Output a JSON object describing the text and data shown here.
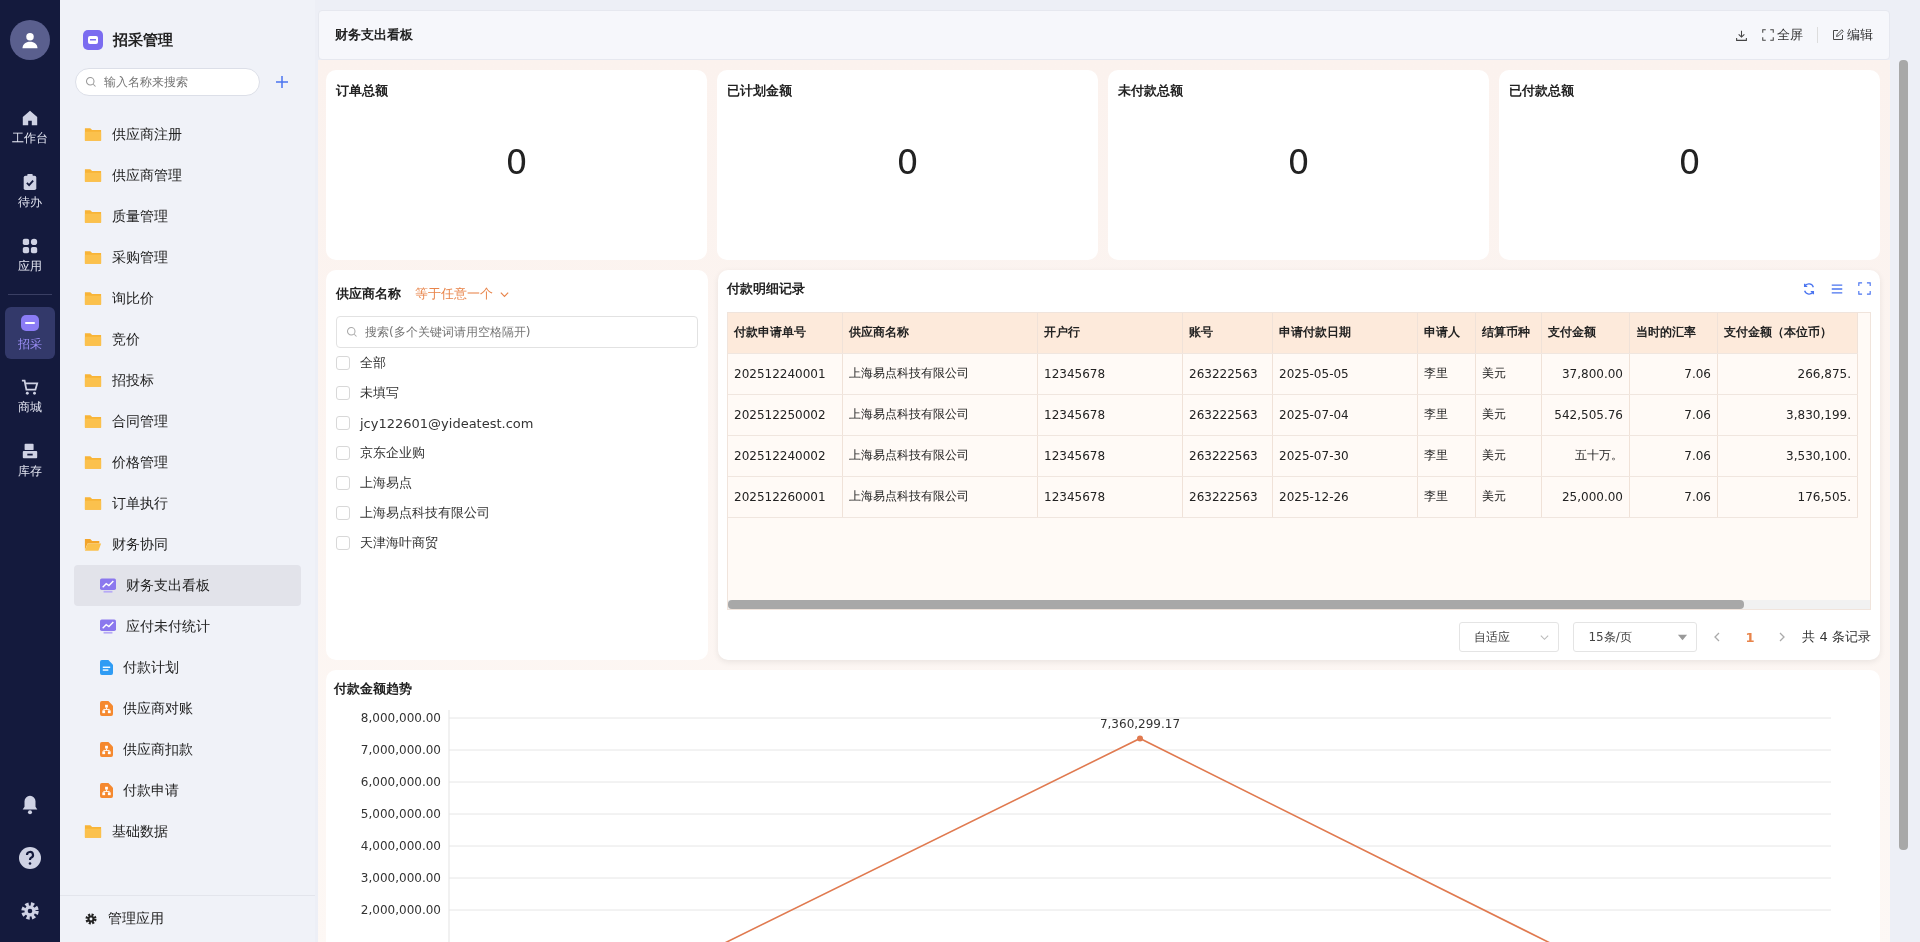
{
  "nav": {
    "items": [
      {
        "label": "工作台",
        "kind": "home",
        "selected": false
      },
      {
        "label": "待办",
        "kind": "todo",
        "selected": false
      },
      {
        "label": "应用",
        "kind": "apps",
        "selected": false
      },
      {
        "label": "招采",
        "kind": "srm",
        "selected": true
      },
      {
        "label": "商城",
        "kind": "cart",
        "selected": false
      },
      {
        "label": "库存",
        "kind": "stock",
        "selected": false
      }
    ]
  },
  "sidebar": {
    "title": "招采管理",
    "search": {
      "placeholder": "输入名称来搜索"
    },
    "items": [
      {
        "label": "供应商注册",
        "kind": "folder",
        "expanded": false,
        "selected": false
      },
      {
        "label": "供应商管理",
        "kind": "folder",
        "expanded": false,
        "selected": false
      },
      {
        "label": "质量管理",
        "kind": "folder",
        "expanded": false,
        "selected": false
      },
      {
        "label": "采购管理",
        "kind": "folder",
        "expanded": false,
        "selected": false
      },
      {
        "label": "询比价",
        "kind": "folder",
        "expanded": false,
        "selected": false
      },
      {
        "label": "竞价",
        "kind": "folder",
        "expanded": false,
        "selected": false
      },
      {
        "label": "招投标",
        "kind": "folder",
        "expanded": false,
        "selected": false
      },
      {
        "label": "合同管理",
        "kind": "folder",
        "expanded": false,
        "selected": false
      },
      {
        "label": "价格管理",
        "kind": "folder",
        "expanded": false,
        "selected": false
      },
      {
        "label": "订单执行",
        "kind": "folder",
        "expanded": false,
        "selected": false
      },
      {
        "label": "财务协同",
        "kind": "folder",
        "expanded": true,
        "selected": false,
        "children": [
          {
            "label": "财务支出看板",
            "kind": "chart",
            "selected": true
          },
          {
            "label": "应付未付统计",
            "kind": "chart",
            "selected": false
          },
          {
            "label": "付款计划",
            "kind": "doc",
            "selected": false
          },
          {
            "label": "供应商对账",
            "kind": "org",
            "selected": false
          },
          {
            "label": "供应商扣款",
            "kind": "org",
            "selected": false
          },
          {
            "label": "付款申请",
            "kind": "org",
            "selected": false
          }
        ]
      },
      {
        "label": "基础数据",
        "kind": "folder",
        "expanded": false,
        "selected": false
      }
    ],
    "footer": "管理应用"
  },
  "header": {
    "title": "财务支出看板",
    "actions": [
      {
        "kind": "download"
      },
      {
        "kind": "fullscreen",
        "label": "全屏"
      },
      {
        "kind": "edit",
        "label": "编辑"
      }
    ]
  },
  "cards": [
    {
      "title": "订单总额",
      "value": "0"
    },
    {
      "title": "已计划金额",
      "value": "0"
    },
    {
      "title": "未付款总额",
      "value": "0"
    },
    {
      "title": "已付款总额",
      "value": "0"
    }
  ],
  "filter": {
    "label": "供应商名称",
    "operator": "等于任意一个",
    "search": {
      "placeholder": "搜索(多个关键词请用空格隔开)"
    },
    "options": [
      {
        "label": "全部",
        "checked": false
      },
      {
        "label": "未填写",
        "checked": false
      },
      {
        "label": "jcy122601@yideatest.com",
        "checked": false
      },
      {
        "label": "京东企业购",
        "checked": false
      },
      {
        "label": "上海易点",
        "checked": false
      },
      {
        "label": "上海易点科技有限公司",
        "checked": false
      },
      {
        "label": "天津海叶商贸",
        "checked": false
      }
    ]
  },
  "table": {
    "title": "付款明细记录",
    "columns": [
      "付款申请单号",
      "供应商名称",
      "开户行",
      "账号",
      "申请付款日期",
      "申请人",
      "结算币种",
      "支付金额",
      "当时的汇率",
      "支付金额（本位币）"
    ],
    "rows": [
      [
        "202512240001",
        "上海易点科技有限公司",
        "12345678",
        "263222563",
        "2025-05-05",
        "李里",
        "美元",
        "37,800.00",
        "7.06",
        "266,875."
      ],
      [
        "202512250002",
        "上海易点科技有限公司",
        "12345678",
        "263222563",
        "2025-07-04",
        "李里",
        "美元",
        "542,505.76",
        "7.06",
        "3,830,199."
      ],
      [
        "202512240002",
        "上海易点科技有限公司",
        "12345678",
        "263222563",
        "2025-07-30",
        "李里",
        "美元",
        "五十万。",
        "7.06",
        "3,530,100."
      ],
      [
        "202512260001",
        "上海易点科技有限公司",
        "12345678",
        "263222563",
        "2025-12-26",
        "李里",
        "美元",
        "25,000.00",
        "7.06",
        "176,505."
      ]
    ],
    "pagination": {
      "fit": "自适应",
      "page_size": "15条/页",
      "pages": [
        {
          "label": "1",
          "selected": true
        }
      ],
      "total": "共 4 条记录"
    }
  },
  "trend": {
    "title": "付款金额趋势",
    "chart_data": {
      "type": "line",
      "ylim": [
        0,
        8000000
      ],
      "yticks": [
        {
          "value": 2000000,
          "label": "2,000,000.00"
        },
        {
          "value": 3000000,
          "label": "3,000,000.00"
        },
        {
          "value": 4000000,
          "label": "4,000,000.00"
        },
        {
          "value": 5000000,
          "label": "5,000,000.00"
        },
        {
          "value": 6000000,
          "label": "6,000,000.00"
        },
        {
          "value": 7000000,
          "label": "7,000,000.00"
        },
        {
          "value": 8000000,
          "label": "8,000,000.00"
        }
      ],
      "grid": true,
      "series": [
        {
          "color": "#e07a50",
          "marker": "circle",
          "values": [
            270000,
            7360299.17,
            180000
          ],
          "value_labels": [
            null,
            "7,360,299.17",
            null
          ]
        }
      ]
    }
  }
}
